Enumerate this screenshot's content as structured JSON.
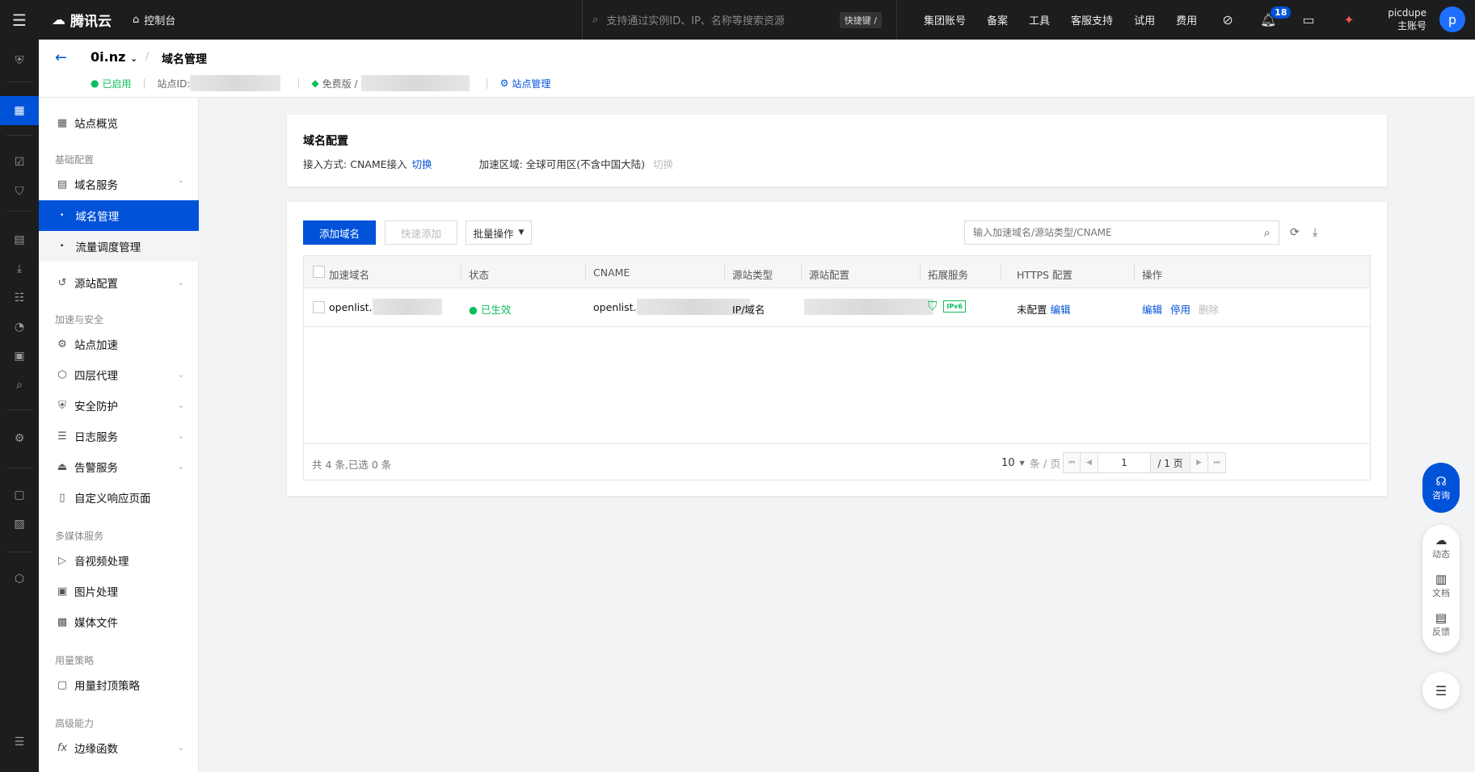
{
  "topbar": {
    "brand": "腾讯云",
    "console": "控制台",
    "search_placeholder": "支持通过实例ID、IP、名称等搜索资源",
    "shortcut": "快捷键 /",
    "nav": [
      "集团账号",
      "备案",
      "工具",
      "客服支持",
      "试用",
      "费用"
    ],
    "notif_count": "18",
    "user_name": "picdupe",
    "user_role": "主账号",
    "avatar_letter": "p"
  },
  "header": {
    "site": "0i.nz",
    "breadcrumb": "域名管理",
    "status": "已启用",
    "site_id_label": "站点ID:",
    "plan": "免费版 /",
    "site_manage": "站点管理"
  },
  "sidebar": {
    "overview": "站点概览",
    "group_basic": "基础配置",
    "domain_service": "域名服务",
    "domain_manage": "域名管理",
    "traffic": "流量调度管理",
    "origin": "源站配置",
    "group_accel": "加速与安全",
    "site_accel": "站点加速",
    "l4_proxy": "四层代理",
    "security": "安全防护",
    "logs": "日志服务",
    "alarm": "告警服务",
    "custom_page": "自定义响应页面",
    "group_media": "多媒体服务",
    "av": "音视频处理",
    "image": "图片处理",
    "media_files": "媒体文件",
    "group_usage": "用量策略",
    "usage_cap": "用量封顶策略",
    "group_adv": "高级能力",
    "edge_func": "边缘函数"
  },
  "config": {
    "title": "域名配置",
    "access_label": "接入方式:",
    "access_value": "CNAME接入",
    "access_switch": "切换",
    "region_label": "加速区域:",
    "region_value": "全球可用区(不含中国大陆)",
    "region_switch": "切换"
  },
  "toolbar": {
    "add_domain": "添加域名",
    "quick_add": "快速添加",
    "batch": "批量操作",
    "search_placeholder": "输入加速域名/源站类型/CNAME"
  },
  "table": {
    "columns": [
      "加速域名",
      "状态",
      "CNAME",
      "源站类型",
      "源站配置",
      "拓展服务",
      "HTTPS 配置",
      "操作"
    ],
    "rows": [
      {
        "domain": "openlist.",
        "status": "已生效",
        "cname": "openlist.",
        "origin_type": "IP/域名",
        "ipv6_badge": "IPv6",
        "https": "未配置",
        "https_edit": "编辑",
        "action_edit": "编辑",
        "action_disable": "停用",
        "action_delete": "删除"
      }
    ],
    "footer_total": "共 4 条,已选 0 条",
    "page_size": "10",
    "page_size_unit": "条 / 页",
    "page_current": "1",
    "page_total": "/ 1 页"
  },
  "float": {
    "consult": "咨询",
    "news": "动态",
    "docs": "文档",
    "feedback": "反馈"
  }
}
